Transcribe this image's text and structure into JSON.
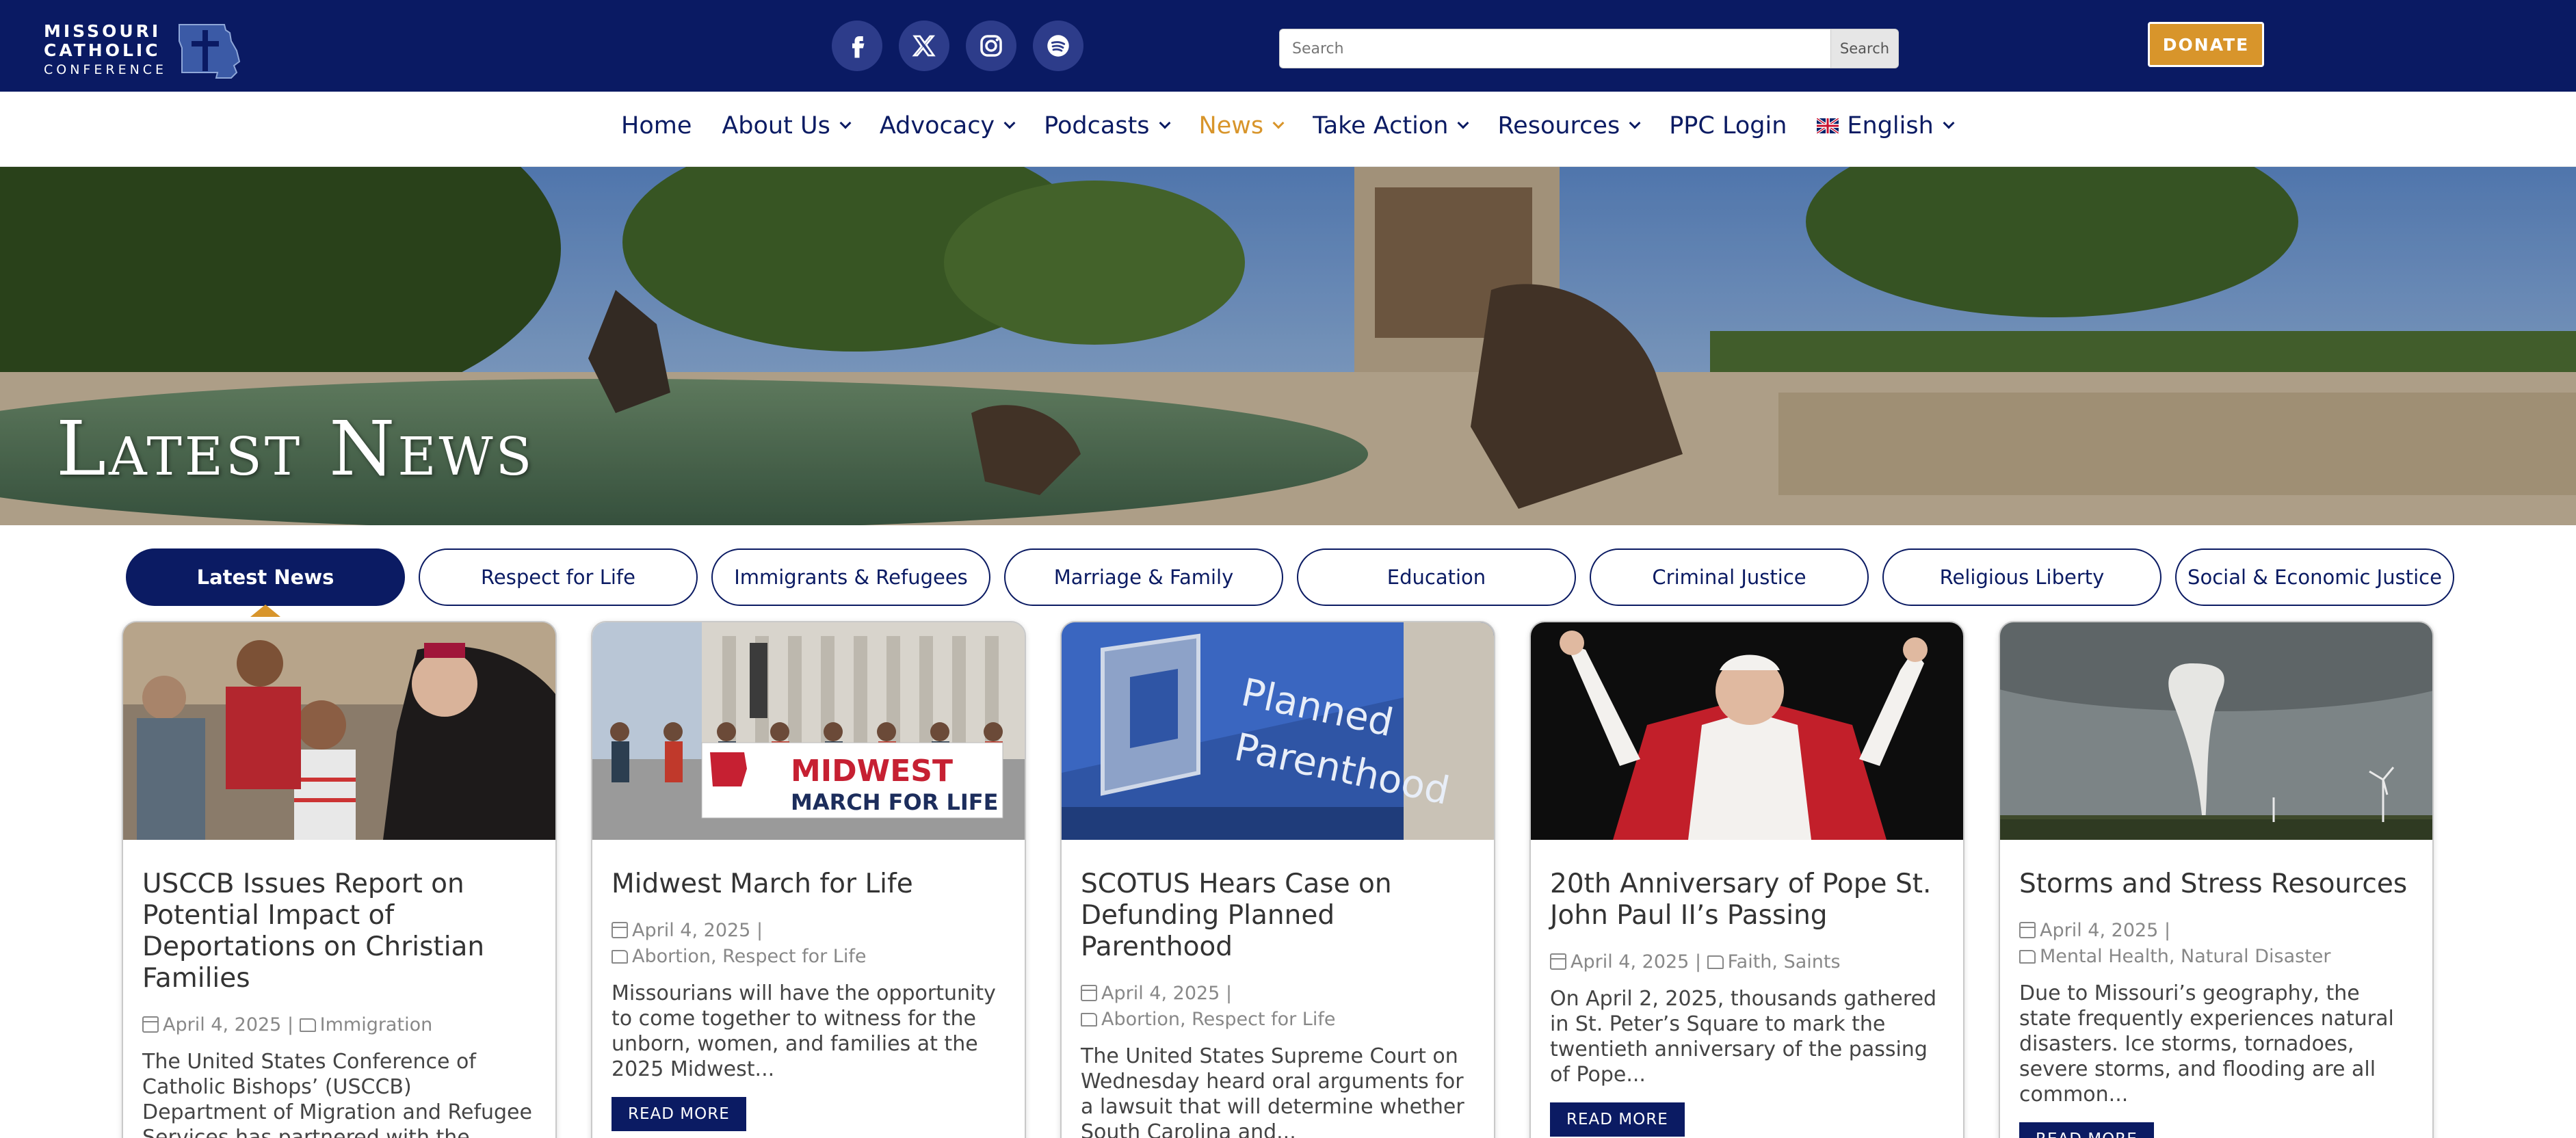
{
  "header": {
    "logo": {
      "line1": "MISSOURI",
      "line2": "CATHOLIC",
      "line3": "CONFERENCE"
    },
    "socials": [
      {
        "name": "facebook-icon",
        "glyph": "f"
      },
      {
        "name": "x-twitter-icon",
        "glyph": "X"
      },
      {
        "name": "instagram-icon",
        "glyph": ""
      },
      {
        "name": "spotify-icon",
        "glyph": ""
      }
    ],
    "search": {
      "placeholder": "Search",
      "button_label": "Search"
    },
    "donate_label": "DONATE"
  },
  "nav": {
    "items": [
      {
        "label": "Home",
        "dropdown": false,
        "active": false
      },
      {
        "label": "About Us",
        "dropdown": true,
        "active": false
      },
      {
        "label": "Advocacy",
        "dropdown": true,
        "active": false
      },
      {
        "label": "Podcasts",
        "dropdown": true,
        "active": false
      },
      {
        "label": "News",
        "dropdown": true,
        "active": true
      },
      {
        "label": "Take Action",
        "dropdown": true,
        "active": false
      },
      {
        "label": "Resources",
        "dropdown": true,
        "active": false
      },
      {
        "label": "PPC Login",
        "dropdown": false,
        "active": false
      },
      {
        "label": "English",
        "dropdown": true,
        "active": false,
        "flag": "uk-flag-icon"
      }
    ]
  },
  "hero": {
    "title": "Latest News"
  },
  "tabs": [
    {
      "label": "Latest News",
      "active": true
    },
    {
      "label": "Respect for Life",
      "active": false
    },
    {
      "label": "Immigrants & Refugees",
      "active": false
    },
    {
      "label": "Marriage & Family",
      "active": false
    },
    {
      "label": "Education",
      "active": false
    },
    {
      "label": "Criminal Justice",
      "active": false
    },
    {
      "label": "Religious Liberty",
      "active": false
    },
    {
      "label": "Social & Economic Justice",
      "active": false
    }
  ],
  "cards": [
    {
      "title": "USCCB Issues Report on Potential Impact of Deportations on Christian Families",
      "date": "April 4, 2025",
      "categories": "Immigration",
      "inline_meta": true,
      "excerpt": "The United States Conference of Catholic Bishops’ (USCCB) Department of Migration and Refugee Services has partnered with the National...",
      "read_more": "",
      "image": "bishop-with-family-photo"
    },
    {
      "title": "Midwest March for Life",
      "date": "April 4, 2025",
      "categories": "Abortion, Respect for Life",
      "inline_meta": false,
      "excerpt": "Missourians will have the opportunity to come together to witness for the unborn, women, and families at the 2025 Midwest...",
      "read_more": "READ MORE",
      "image": "march-for-life-banner-photo",
      "banner_top": "MIDWEST",
      "banner_bottom": "MARCH FOR LIFE"
    },
    {
      "title": "SCOTUS Hears Case on Defunding Planned Parenthood",
      "date": "April 4, 2025",
      "categories": "Abortion, Respect for Life",
      "inline_meta": false,
      "excerpt": "The United States Supreme Court on Wednesday heard oral arguments for a lawsuit that will determine whether South Carolina and...",
      "read_more": "",
      "image": "planned-parenthood-sign-photo",
      "sign_line1": "Planned",
      "sign_line2": "Parenthood"
    },
    {
      "title": "20th Anniversary of Pope St. John Paul II’s Passing",
      "date": "April 4, 2025",
      "categories": "Faith, Saints",
      "inline_meta": true,
      "excerpt": "On April 2, 2025, thousands gathered in St. Peter’s Square to mark the twentieth anniversary of the passing of Pope...",
      "read_more": "READ MORE",
      "image": "pope-john-paul-ii-photo"
    },
    {
      "title": "Storms and Stress Resources",
      "date": "April 4, 2025",
      "categories": "Mental Health, Natural Disaster",
      "inline_meta": false,
      "excerpt": "Due to Missouri’s geography, the state frequently experiences natural disasters. Ice storms, tornadoes, severe storms, and flooding are all common...",
      "read_more": "READ MORE",
      "image": "tornado-photo"
    }
  ],
  "colors": {
    "navy": "#0a1a63",
    "gold": "#d8952b",
    "text": "#333333",
    "meta": "#888888"
  }
}
